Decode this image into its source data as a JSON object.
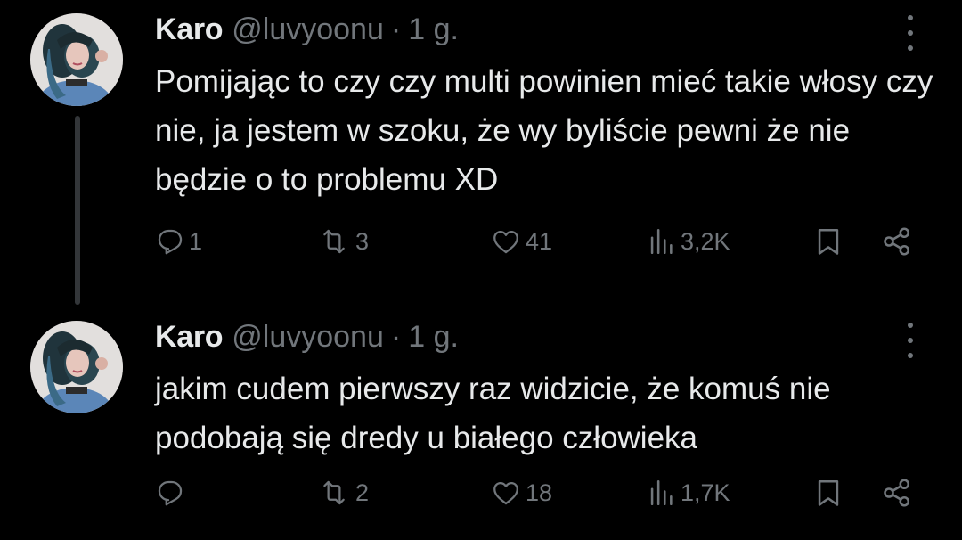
{
  "tweets": [
    {
      "author_name": "Karo",
      "handle": "@luvyoonu",
      "separator": "·",
      "time": "1 g.",
      "text": "Pomijając to czy czy multi powinien mieć takie włosy czy nie, ja jestem w szoku, że wy byliście pewni że nie będzie o to problemu XD",
      "replies": "1",
      "retweets": "3",
      "likes": "41",
      "views": "3,2K"
    },
    {
      "author_name": "Karo",
      "handle": "@luvyoonu",
      "separator": "·",
      "time": "1 g.",
      "text": "jakim cudem pierwszy raz widzicie, że komuś nie podobają się dredy u białego człowieka",
      "replies": "",
      "retweets": "2",
      "likes": "18",
      "views": "1,7K"
    }
  ],
  "icons": {
    "reply": "reply-icon",
    "retweet": "retweet-icon",
    "like": "heart-icon",
    "views": "views-icon",
    "bookmark": "bookmark-icon",
    "share": "share-icon",
    "more": "more-icon"
  },
  "colors": {
    "background": "#000000",
    "text_primary": "#e7e9ea",
    "text_secondary": "#71767b",
    "thread_line": "#333639"
  }
}
